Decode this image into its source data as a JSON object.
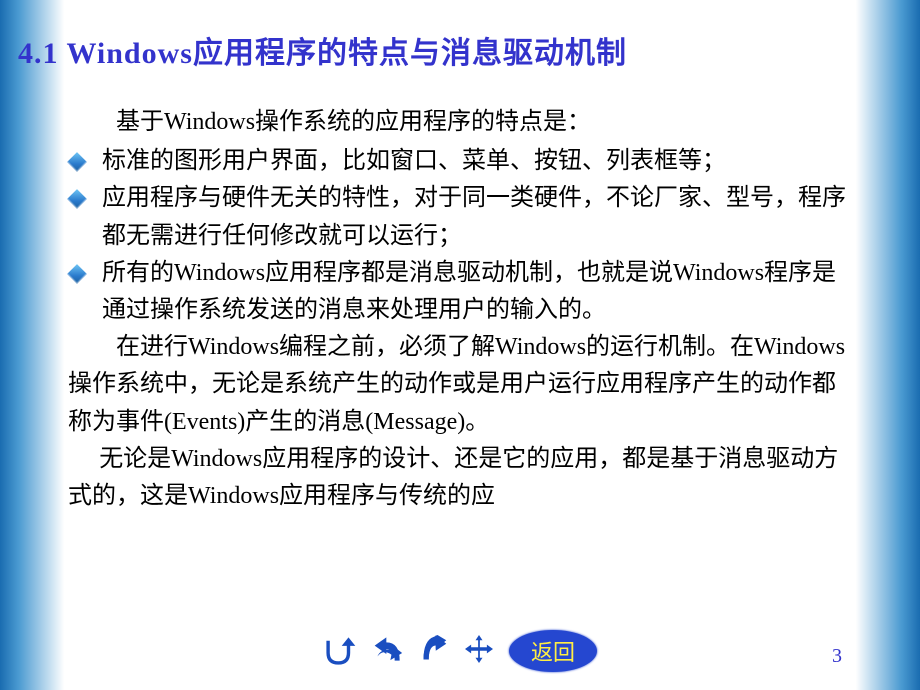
{
  "title": "4.1 Windows应用程序的特点与消息驱动机制",
  "intro": "基于Windows操作系统的应用程序的特点是：",
  "bullets": [
    "标准的图形用户界面，比如窗口、菜单、按钮、列表框等；",
    "应用程序与硬件无关的特性，对于同一类硬件，不论厂家、型号，程序都无需进行任何修改就可以运行；",
    "所有的Windows应用程序都是消息驱动机制，也就是说Windows程序是通过操作系统发送的消息来处理用户的输入的。"
  ],
  "para1": "在进行Windows编程之前，必须了解Windows的运行机制。在Windows操作系统中，无论是系统产生的动作或是用户运行应用程序产生的动作都称为事件(Events)产生的消息(Message)。",
  "para2": "无论是Windows应用程序的设计、还是它的应用，都是基于消息驱动方式的，这是Windows应用程序与传统的应",
  "nav": {
    "return_label": "返回"
  },
  "page_number": "3"
}
